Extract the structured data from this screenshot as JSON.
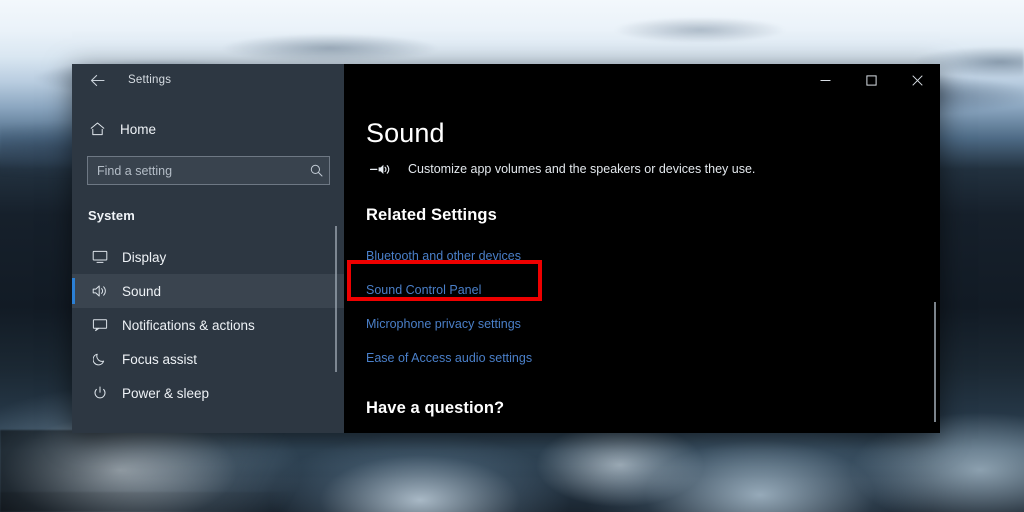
{
  "window": {
    "app_title": "Settings",
    "back_icon": "back-arrow-icon",
    "controls": {
      "minimize": "–",
      "maximize": "□",
      "close": "×"
    }
  },
  "sidebar": {
    "home": {
      "label": "Home",
      "icon": "home-icon"
    },
    "search": {
      "value": "",
      "placeholder": "Find a setting",
      "icon": "search-icon"
    },
    "section_title": "System",
    "items": [
      {
        "label": "Display",
        "icon": "monitor-icon",
        "selected": false
      },
      {
        "label": "Sound",
        "icon": "speaker-icon",
        "selected": true
      },
      {
        "label": "Notifications & actions",
        "icon": "notification-icon",
        "selected": false
      },
      {
        "label": "Focus assist",
        "icon": "moon-icon",
        "selected": false
      },
      {
        "label": "Power & sleep",
        "icon": "power-icon",
        "selected": false
      }
    ]
  },
  "main": {
    "title": "Sound",
    "subtitle": "Customize app volumes and the speakers or devices they use.",
    "subtitle_icon": "volume-speaker-icon",
    "related_settings_heading": "Related Settings",
    "related_links": [
      "Bluetooth and other devices",
      "Sound Control Panel",
      "Microphone privacy settings",
      "Ease of Access audio settings"
    ],
    "question_heading": "Have a question?"
  },
  "annotation": {
    "target_label": "Sound Control Panel",
    "color": "#ee0000"
  },
  "colors": {
    "accent_blue": "#2b7fd4",
    "link_blue": "#4a7fc8",
    "sidebar_bg": "#2d3742",
    "content_bg": "#000000",
    "highlight_red": "#ee0000"
  }
}
